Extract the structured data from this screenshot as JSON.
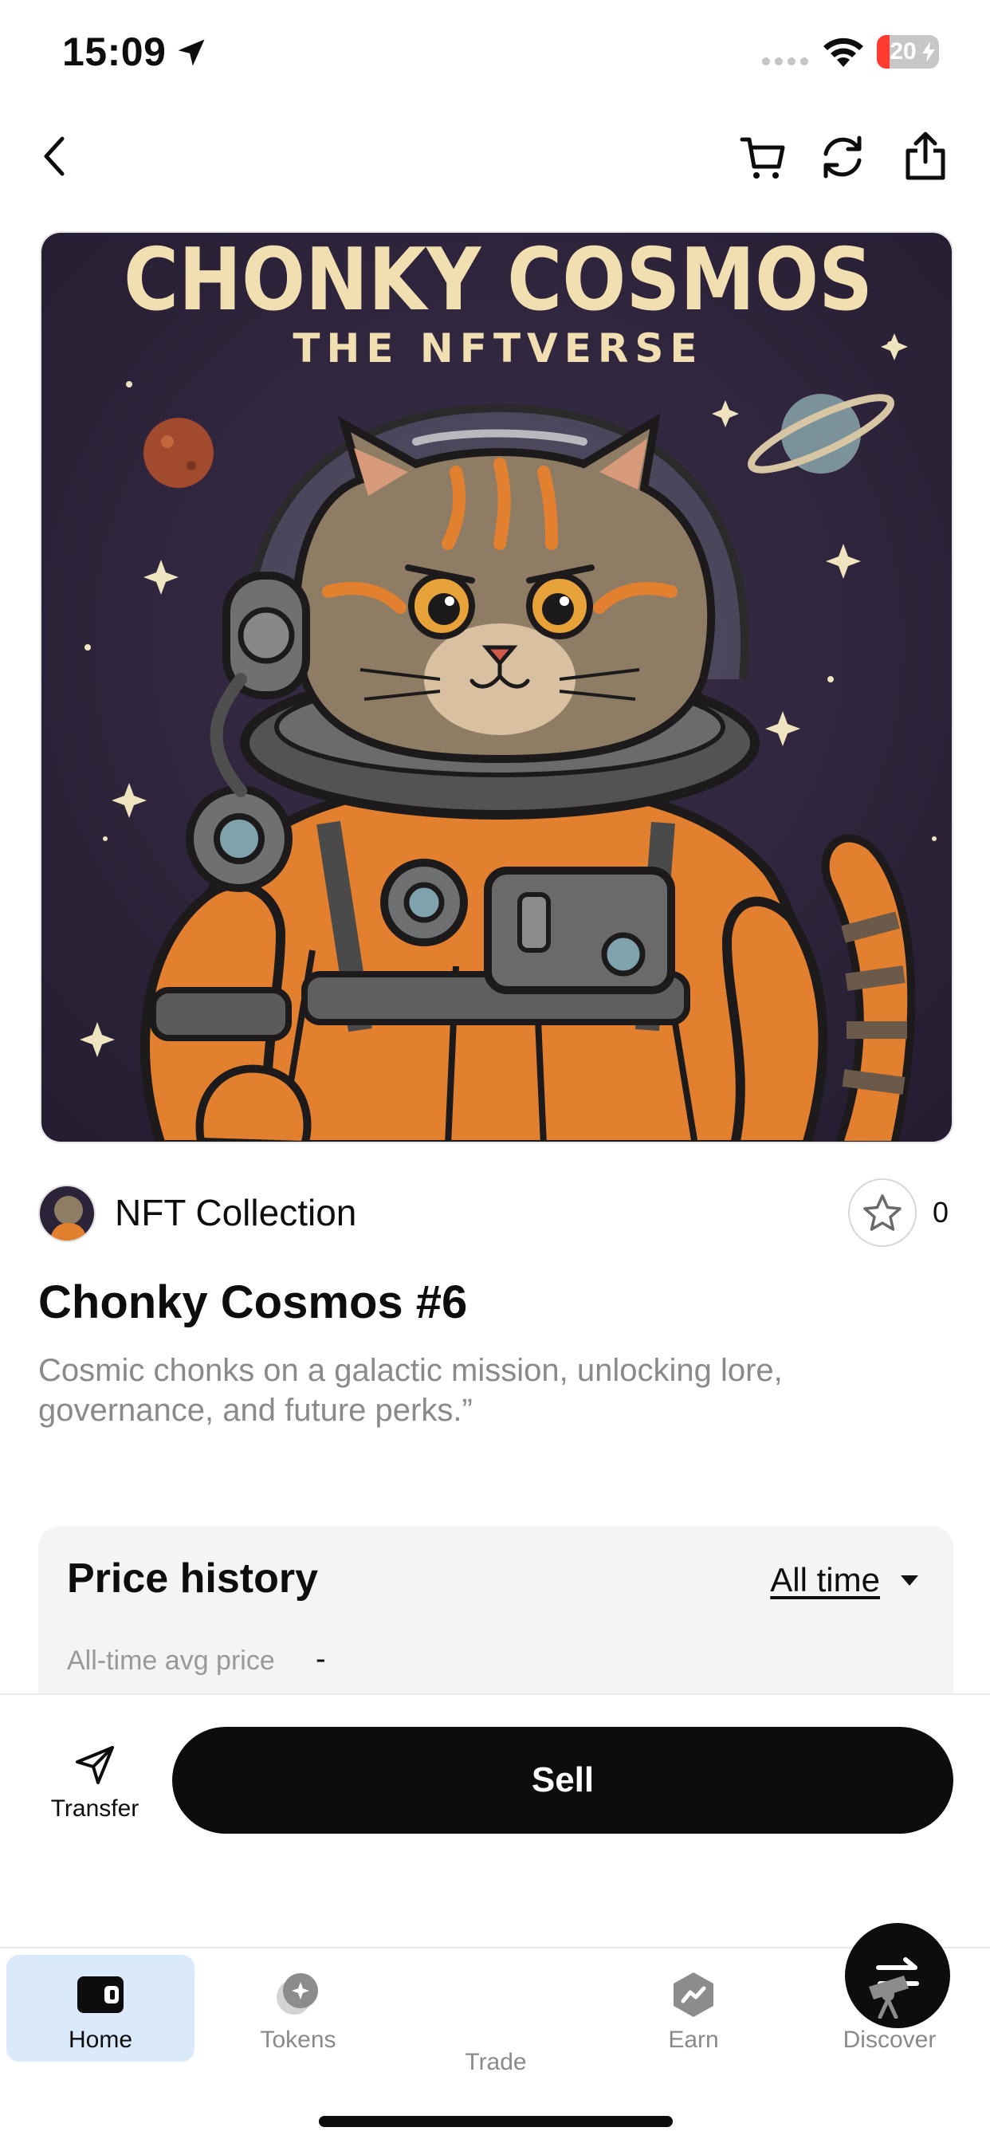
{
  "status_bar": {
    "time": "15:09",
    "battery_level": "20",
    "battery_fraction": 0.2,
    "icons": [
      "location-arrow-icon",
      "cellular-dots-icon",
      "wifi-icon",
      "battery-charging-icon"
    ]
  },
  "nav": {
    "icons": [
      "chevron-left-icon",
      "cart-icon",
      "refresh-icon",
      "share-icon"
    ]
  },
  "nft": {
    "art_title": "CHONKY COSMOS",
    "art_subtitle": "THE NFTVERSE",
    "collection_label": "NFT Collection",
    "favorite_count": "0",
    "title": "Chonky Cosmos #6",
    "description": "Cosmic chonks on a galactic mission, unlocking lore, governance, and future perks.”"
  },
  "price_history": {
    "title": "Price history",
    "range": "All time",
    "avg_label": "All-time avg price",
    "avg_value": "-"
  },
  "actions": {
    "transfer_label": "Transfer",
    "sell_label": "Sell"
  },
  "tabs": [
    {
      "label": "Home",
      "icon": "wallet-icon",
      "active": true
    },
    {
      "label": "Tokens",
      "icon": "tokens-icon",
      "active": false
    },
    {
      "label": "Trade",
      "icon": "swap-arrows-icon",
      "active": false
    },
    {
      "label": "Earn",
      "icon": "earn-icon",
      "active": false
    },
    {
      "label": "Discover",
      "icon": "telescope-icon",
      "active": false
    }
  ],
  "colors": {
    "accent_active_tab": "#dbeafb",
    "primary_button": "#0d0d0d",
    "battery_low": "#ff3b30",
    "art_background": "#2b2338",
    "art_title": "#f1dfb2"
  }
}
